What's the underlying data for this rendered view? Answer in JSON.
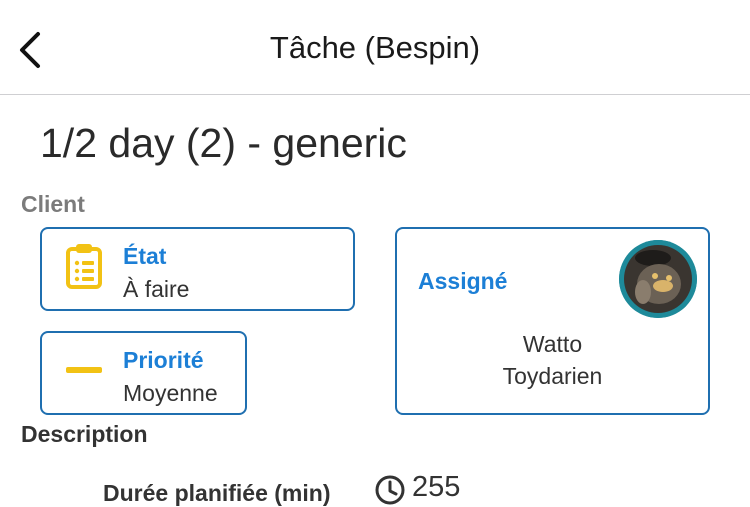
{
  "header": {
    "title": "Tâche (Bespin)"
  },
  "task": {
    "title": "1/2 day (2) - generic"
  },
  "client": {
    "label": "Client"
  },
  "state": {
    "label": "État",
    "value": "À faire"
  },
  "priority": {
    "label": "Priorité",
    "value": "Moyenne"
  },
  "assigned": {
    "label": "Assigné",
    "first_name": "Watto",
    "last_name": "Toydarien"
  },
  "description": {
    "label": "Description"
  },
  "duration": {
    "label": "Durée planifiée (min)",
    "value": "255"
  },
  "colors": {
    "accent": "#1c7fd6",
    "border": "#1f6fb0",
    "priority_medium": "#f2c214",
    "state_icon": "#f2c214"
  },
  "icons": {
    "back": "chevron-left-icon",
    "state": "clipboard-icon",
    "priority": "dash-icon",
    "duration": "clock-icon"
  }
}
